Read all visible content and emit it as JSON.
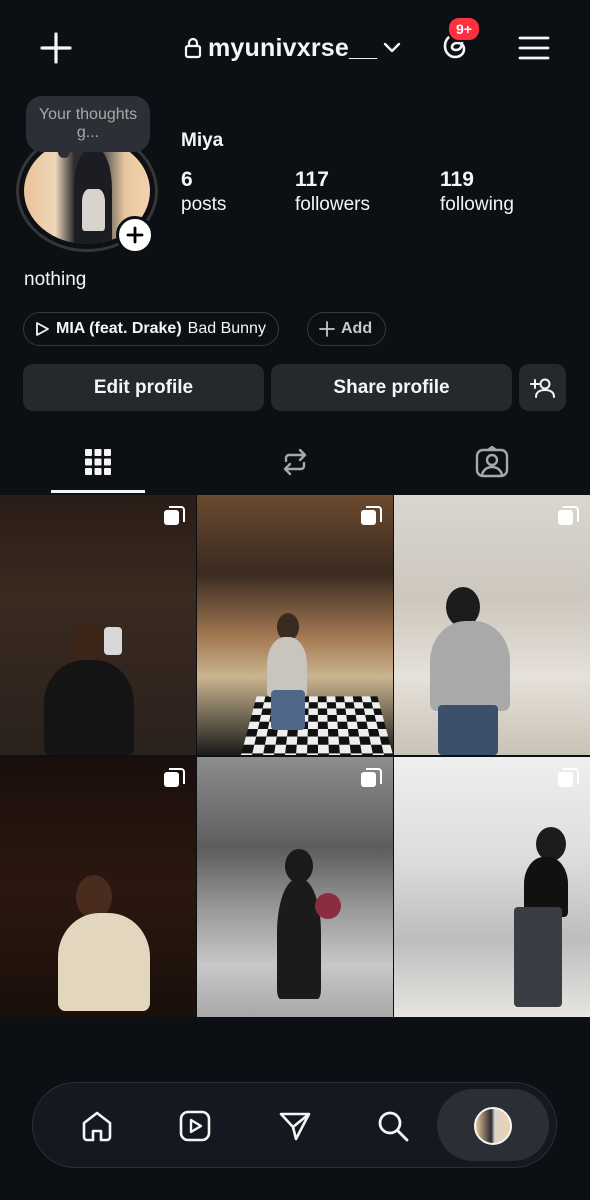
{
  "header": {
    "username": "myunivxrse__",
    "notification_badge": "9+",
    "icons": [
      "plus-icon",
      "lock-icon",
      "chevron-down-icon",
      "threads-icon",
      "menu-icon"
    ]
  },
  "profile": {
    "note_text": "Your thoughts g...",
    "display_name": "Miya",
    "bio": "nothing",
    "stats": {
      "posts_count": "6",
      "posts_label": "posts",
      "followers_count": "117",
      "followers_label": "followers",
      "following_count": "119",
      "following_label": "following"
    },
    "music": {
      "title": "MIA (feat. Drake)",
      "artist": "Bad Bunny"
    },
    "add_label": "Add",
    "buttons": {
      "edit": "Edit profile",
      "share": "Share profile"
    }
  },
  "tabs": [
    "grid-icon",
    "reposts-icon",
    "tagged-icon"
  ],
  "posts": [
    {
      "type": "carousel"
    },
    {
      "type": "carousel"
    },
    {
      "type": "carousel"
    },
    {
      "type": "carousel"
    },
    {
      "type": "carousel"
    },
    {
      "type": "carousel"
    }
  ],
  "bottom_nav": [
    "home-icon",
    "reels-icon",
    "messages-icon",
    "search-icon",
    "profile-avatar"
  ],
  "colors": {
    "background": "#0c1014",
    "badge": "#ff3040",
    "button_bg": "#25292e"
  }
}
